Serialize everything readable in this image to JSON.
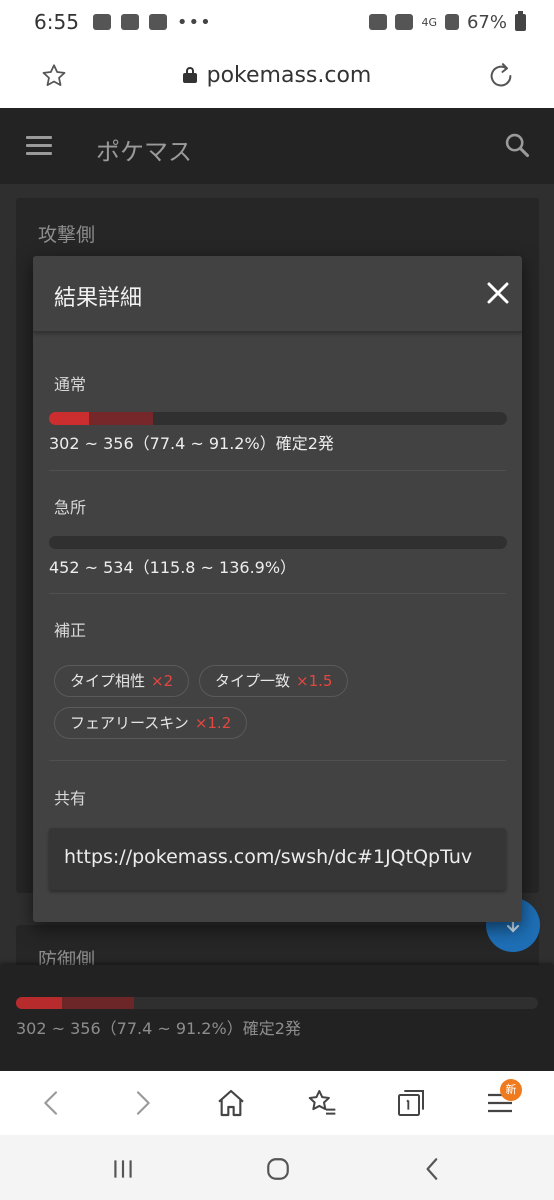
{
  "status_bar": {
    "time": "6:55",
    "network": "4G",
    "battery": "67%"
  },
  "browser": {
    "url": "pokemass.com"
  },
  "app": {
    "title": "ポケマス"
  },
  "page": {
    "attacker_title": "攻撃側",
    "defender_title": "防御側"
  },
  "modal": {
    "title": "結果詳細",
    "normal": {
      "label": "通常",
      "range": "302 ~ 356（77.4 ~ 91.2%）確定2発",
      "min_pct": 77.4,
      "max_pct": 91.2
    },
    "critical": {
      "label": "急所",
      "range": "452 ~ 534（115.8 ~ 136.9%）",
      "min_pct": 115.8,
      "max_pct": 136.9
    },
    "modifiers": {
      "label": "補正",
      "chips": [
        {
          "name": "タイプ相性",
          "mult": "×2"
        },
        {
          "name": "タイプ一致",
          "mult": "×1.5"
        },
        {
          "name": "フェアリースキン",
          "mult": "×1.2"
        }
      ]
    },
    "share": {
      "label": "共有",
      "url": "https://pokemass.com/swsh/dc#1JQtQpTuv"
    }
  },
  "result_bar": {
    "range": "302 ~ 356（77.4 ~ 91.2%）確定2発",
    "min_pct": 77.4,
    "max_pct": 91.2
  },
  "browser_nav": {
    "badge": "新"
  }
}
